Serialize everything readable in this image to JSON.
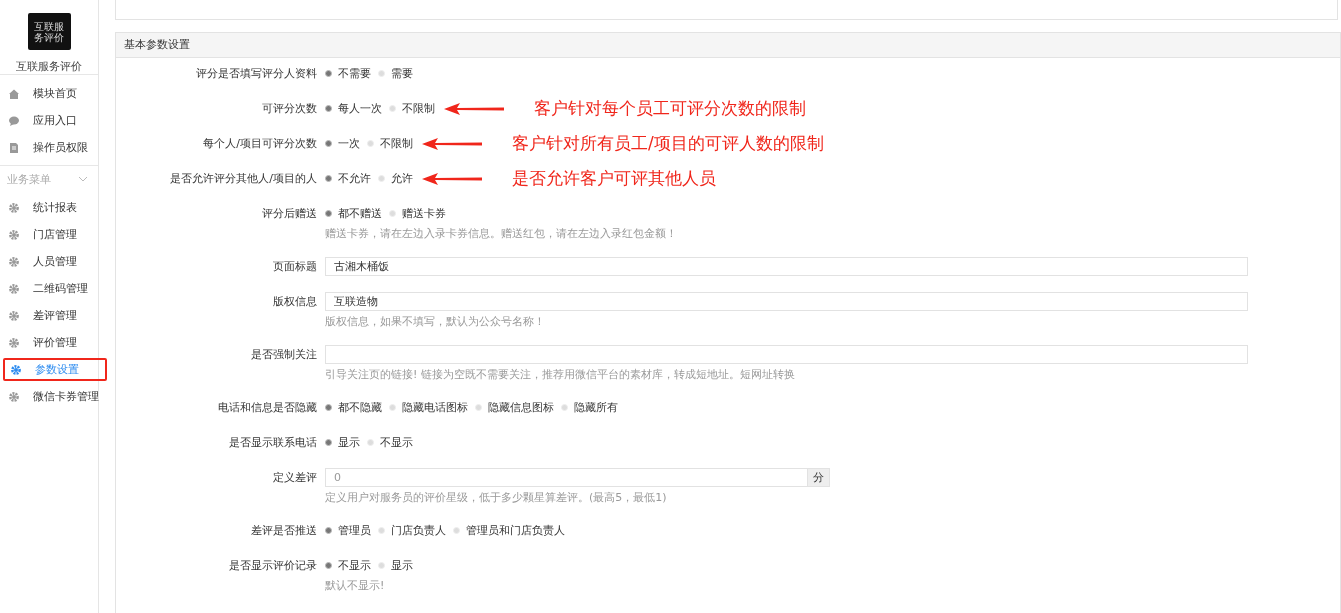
{
  "sidebar": {
    "logo_text": "互联服务评价",
    "app_name": "互联服务评价",
    "top_items": [
      {
        "label": "模块首页",
        "kind": "home",
        "selected": false
      },
      {
        "label": "应用入口",
        "kind": "chat",
        "selected": false
      },
      {
        "label": "操作员权限",
        "kind": "doc",
        "selected": false
      }
    ],
    "group": {
      "title": "业务菜单",
      "expanded": true,
      "items": [
        {
          "label": "统计报表",
          "selected": false
        },
        {
          "label": "门店管理",
          "selected": false
        },
        {
          "label": "人员管理",
          "selected": false
        },
        {
          "label": "二维码管理",
          "selected": false
        },
        {
          "label": "差评管理",
          "selected": false
        },
        {
          "label": "评价管理",
          "selected": false
        },
        {
          "label": "参数设置",
          "selected": true
        },
        {
          "label": "微信卡券管理",
          "selected": false
        }
      ]
    }
  },
  "panel": {
    "title": "基本参数设置",
    "rows": [
      {
        "kind": "radio",
        "label": "评分是否填写评分人资料",
        "options": [
          {
            "label": "不需要",
            "selected": true
          },
          {
            "label": "需要",
            "selected": false
          }
        ]
      },
      {
        "kind": "radio",
        "label": "可评分次数",
        "options": [
          {
            "label": "每人一次",
            "selected": true
          },
          {
            "label": "不限制",
            "selected": false
          }
        ],
        "annotation": "客户针对每个员工可评分次数的限制"
      },
      {
        "kind": "radio",
        "label": "每个人/项目可评分次数",
        "options": [
          {
            "label": "一次",
            "selected": true
          },
          {
            "label": "不限制",
            "selected": false
          }
        ],
        "annotation": "客户针对所有员工/项目的可评人数的限制"
      },
      {
        "kind": "radio",
        "label": "是否允许评分其他人/项目的人",
        "options": [
          {
            "label": "不允许",
            "selected": true
          },
          {
            "label": "允许",
            "selected": false
          }
        ],
        "annotation": "是否允许客户可评其他人员"
      },
      {
        "kind": "radio",
        "label": "评分后赠送",
        "options": [
          {
            "label": "都不赠送",
            "selected": true
          },
          {
            "label": "赠送卡券",
            "selected": false
          }
        ],
        "help": "赠送卡券，请在左边入录卡券信息。赠送红包，请在左边入录红包金额！"
      },
      {
        "kind": "text",
        "label": "页面标题",
        "value": "古湘木桶饭"
      },
      {
        "kind": "text",
        "label": "版权信息",
        "value": "互联造物",
        "help": "版权信息，如果不填写，默认为公众号名称！"
      },
      {
        "kind": "text",
        "label": "是否强制关注",
        "help": "引导关注页的链接! 链接为空既不需要关注，推荐用微信平台的素材库，转成短地址。短网址转换"
      },
      {
        "kind": "radio",
        "label": "电话和信息是否隐藏",
        "options": [
          {
            "label": "都不隐藏",
            "selected": true
          },
          {
            "label": "隐藏电话图标",
            "selected": false
          },
          {
            "label": "隐藏信息图标",
            "selected": false
          },
          {
            "label": "隐藏所有",
            "selected": false
          }
        ]
      },
      {
        "kind": "radio",
        "label": "是否显示联系电话",
        "options": [
          {
            "label": "显示",
            "selected": true
          },
          {
            "label": "不显示",
            "selected": false
          }
        ]
      },
      {
        "kind": "addon",
        "label": "定义差评",
        "placeholder": "0",
        "addon": "分",
        "help": "定义用户对服务员的评价星级，低于多少颗星算差评。(最高5，最低1)"
      },
      {
        "kind": "radio",
        "label": "差评是否推送",
        "options": [
          {
            "label": "管理员",
            "selected": true
          },
          {
            "label": "门店负责人",
            "selected": false
          },
          {
            "label": "管理员和门店负责人",
            "selected": false
          }
        ]
      },
      {
        "kind": "radio",
        "label": "是否显示评价记录",
        "options": [
          {
            "label": "不显示",
            "selected": true
          },
          {
            "label": "显示",
            "selected": false
          }
        ],
        "help": "默认不显示!"
      }
    ]
  }
}
